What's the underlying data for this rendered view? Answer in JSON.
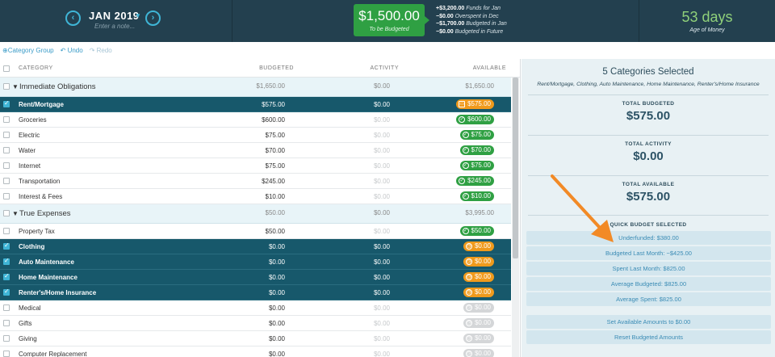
{
  "header": {
    "month": "JAN 2019",
    "note_placeholder": "Enter a note...",
    "to_be_budgeted": {
      "amount": "$1,500.00",
      "label": "To be Budgeted"
    },
    "breakdown": [
      {
        "amount": "+$3,200.00",
        "label": "Funds for Jan"
      },
      {
        "amount": "−$0.00",
        "label": "Overspent in Dec"
      },
      {
        "amount": "−$1,700.00",
        "label": "Budgeted in Jan"
      },
      {
        "amount": "−$0.00",
        "label": "Budgeted in Future"
      }
    ],
    "age_of_money": {
      "value": "53 days",
      "label": "Age of Money"
    }
  },
  "toolbar": {
    "category_group": "Category Group",
    "undo": "Undo",
    "redo": "Redo"
  },
  "columns": {
    "category": "CATEGORY",
    "budgeted": "BUDGETED",
    "activity": "ACTIVITY",
    "available": "AVAILABLE"
  },
  "rows": [
    {
      "type": "group",
      "name": "Immediate Obligations",
      "budgeted": "$1,650.00",
      "activity": "$0.00",
      "available": "$1,650.00"
    },
    {
      "type": "cat",
      "selected": true,
      "name": "Rent/Mortgage",
      "budgeted": "$575.00",
      "activity": "$0.00",
      "available": "$575.00",
      "pill": "orange",
      "icon": "calendar"
    },
    {
      "type": "cat",
      "name": "Groceries",
      "budgeted": "$600.00",
      "activity": "$0.00",
      "available": "$600.00",
      "pill": "green",
      "icon": "check"
    },
    {
      "type": "cat",
      "name": "Electric",
      "budgeted": "$75.00",
      "activity": "$0.00",
      "available": "$75.00",
      "pill": "green",
      "icon": "check"
    },
    {
      "type": "cat",
      "name": "Water",
      "budgeted": "$70.00",
      "activity": "$0.00",
      "available": "$70.00",
      "pill": "green",
      "icon": "check"
    },
    {
      "type": "cat",
      "name": "Internet",
      "budgeted": "$75.00",
      "activity": "$0.00",
      "available": "$75.00",
      "pill": "green",
      "icon": "check"
    },
    {
      "type": "cat",
      "name": "Transportation",
      "budgeted": "$245.00",
      "activity": "$0.00",
      "available": "$245.00",
      "pill": "green",
      "icon": "check"
    },
    {
      "type": "cat",
      "name": "Interest & Fees",
      "budgeted": "$10.00",
      "activity": "$0.00",
      "available": "$10.00",
      "pill": "green",
      "icon": "check"
    },
    {
      "type": "group",
      "name": "True Expenses",
      "budgeted": "$50.00",
      "activity": "$0.00",
      "available": "$3,995.00"
    },
    {
      "type": "cat",
      "name": "Property Tax",
      "budgeted": "$50.00",
      "activity": "$0.00",
      "available": "$50.00",
      "pill": "green",
      "icon": "check"
    },
    {
      "type": "cat",
      "selected": true,
      "name": "Clothing",
      "budgeted": "$0.00",
      "activity": "$0.00",
      "available": "$0.00",
      "pill": "orange",
      "icon": "clock"
    },
    {
      "type": "cat",
      "selected": true,
      "name": "Auto Maintenance",
      "budgeted": "$0.00",
      "activity": "$0.00",
      "available": "$0.00",
      "pill": "orange",
      "icon": "clock"
    },
    {
      "type": "cat",
      "selected": true,
      "name": "Home Maintenance",
      "budgeted": "$0.00",
      "activity": "$0.00",
      "available": "$0.00",
      "pill": "orange",
      "icon": "clock"
    },
    {
      "type": "cat",
      "selected": true,
      "name": "Renter's/Home Insurance",
      "budgeted": "$0.00",
      "activity": "$0.00",
      "available": "$0.00",
      "pill": "orange",
      "icon": "clock"
    },
    {
      "type": "cat",
      "name": "Medical",
      "budgeted": "$0.00",
      "activity": "$0.00",
      "available": "$0.00",
      "pill": "gray",
      "icon": "clock"
    },
    {
      "type": "cat",
      "name": "Gifts",
      "budgeted": "$0.00",
      "activity": "$0.00",
      "available": "$0.00",
      "pill": "gray",
      "icon": "clock"
    },
    {
      "type": "cat",
      "name": "Giving",
      "budgeted": "$0.00",
      "activity": "$0.00",
      "available": "$0.00",
      "pill": "gray",
      "icon": "clock"
    },
    {
      "type": "cat",
      "name": "Computer Replacement",
      "budgeted": "$0.00",
      "activity": "$0.00",
      "available": "$0.00",
      "pill": "gray",
      "icon": "clock"
    }
  ],
  "inspector": {
    "title": "5 Categories Selected",
    "subtitle": "Rent/Mortgage, Clothing, Auto Maintenance, Home Maintenance, Renter's/Home Insurance",
    "total_budgeted": {
      "label": "TOTAL BUDGETED",
      "value": "$575.00"
    },
    "total_activity": {
      "label": "TOTAL ACTIVITY",
      "value": "$0.00"
    },
    "total_available": {
      "label": "TOTAL AVAILABLE",
      "value": "$575.00"
    },
    "quick_budget_title": "QUICK BUDGET SELECTED",
    "quick_budget": [
      "Underfunded: $380.00",
      "Budgeted Last Month: −$425.00",
      "Spent Last Month: $825.00",
      "Average Budgeted: $825.00",
      "Average Spent: $825.00"
    ],
    "actions": [
      "Set Available Amounts to $0.00",
      "Reset Budgeted Amounts"
    ]
  },
  "colors": {
    "header_bg": "#23404f",
    "accent_blue": "#3fb5d6",
    "funded_green": "#2fa043",
    "underfunded_orange": "#f09a1c",
    "selected_row": "#17586b",
    "annotation_arrow": "#f28a26"
  }
}
